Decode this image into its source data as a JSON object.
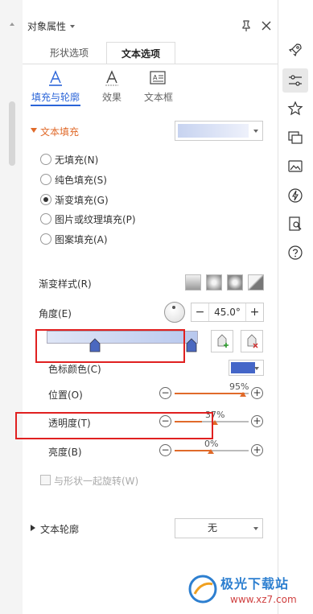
{
  "panel": {
    "title": "对象属性"
  },
  "tabs": [
    {
      "label": "形状选项",
      "active": false
    },
    {
      "label": "文本选项",
      "active": true
    }
  ],
  "subtabs": [
    {
      "label": "填充与轮廓",
      "icon": "text-fill-icon",
      "active": true
    },
    {
      "label": "效果",
      "icon": "text-effect-icon",
      "active": false
    },
    {
      "label": "文本框",
      "icon": "textbox-icon",
      "active": false
    }
  ],
  "text_fill": {
    "title": "文本填充",
    "options": [
      {
        "label": "无填充(N)",
        "selected": false
      },
      {
        "label": "纯色填充(S)",
        "selected": false
      },
      {
        "label": "渐变填充(G)",
        "selected": true
      },
      {
        "label": "图片或纹理填充(P)",
        "selected": false
      },
      {
        "label": "图案填充(A)",
        "selected": false
      }
    ],
    "gradient_style_label": "渐变样式(R)",
    "angle_label": "角度(E)",
    "angle_value": "45.0°",
    "angle_minus": "−",
    "angle_plus": "+",
    "stop_color_label": "色标颜色(C)",
    "stop_color": "#4466c8",
    "position_label": "位置(O)",
    "position_value": "95%",
    "transparency_label": "透明度(T)",
    "transparency_value": "37%",
    "brightness_label": "亮度(B)",
    "brightness_value": "0%",
    "rotate_with_shape_label": "与形状一起旋转(W)"
  },
  "text_outline": {
    "title": "文本轮廓",
    "value": "无"
  },
  "right_rail": {
    "icons": [
      "rocket-icon",
      "properties-icon",
      "star-icon",
      "transition-icon",
      "image-icon",
      "lightning-icon",
      "book-search-icon",
      "help-icon"
    ]
  },
  "watermark": {
    "brand": "极光下载站",
    "url": "www.xz7.com"
  },
  "colors": {
    "accent": "#2a64d8",
    "section": "#e06a2a",
    "highlight_box": "#e02020"
  }
}
